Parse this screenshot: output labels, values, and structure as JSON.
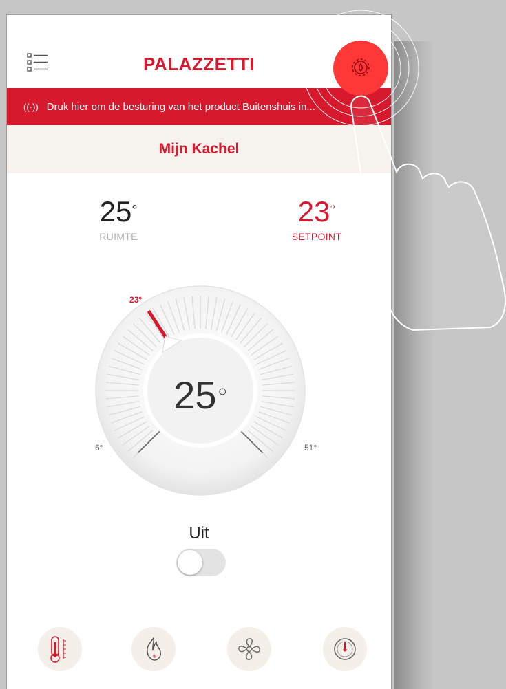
{
  "header": {
    "brand": "PALAZZETTI",
    "menu_icon": "list-menu-icon",
    "settings_icon": "flame-gear-icon"
  },
  "banner": {
    "icon": "wireless-signal-icon",
    "signal_glyph": "((·))",
    "text": "Druk hier om de besturing van het product Buitenshuis in..."
  },
  "stove": {
    "name": "Mijn Kachel"
  },
  "temperatures": {
    "room_value": "25",
    "room_label": "RUIMTE",
    "setpoint_value": "23",
    "setpoint_label": "SETPOINT",
    "degree": "°"
  },
  "dial": {
    "current": "25",
    "marker_label": "23°",
    "min_label": "6°",
    "max_label": "51°",
    "min": 6,
    "max": 51,
    "setpoint": 23
  },
  "mode": {
    "label": "Uit",
    "toggle_on": false
  },
  "bottom_tabs": [
    {
      "icon": "thermometer-icon",
      "active": true
    },
    {
      "icon": "flame-icon",
      "active": false
    },
    {
      "icon": "fan-icon",
      "active": false
    },
    {
      "icon": "gauge-icon",
      "active": false
    }
  ],
  "colors": {
    "accent": "#d7192d",
    "highlight": "#ff3737",
    "background": "#c6c6c6",
    "subheader_bg": "#f6f2ee"
  }
}
